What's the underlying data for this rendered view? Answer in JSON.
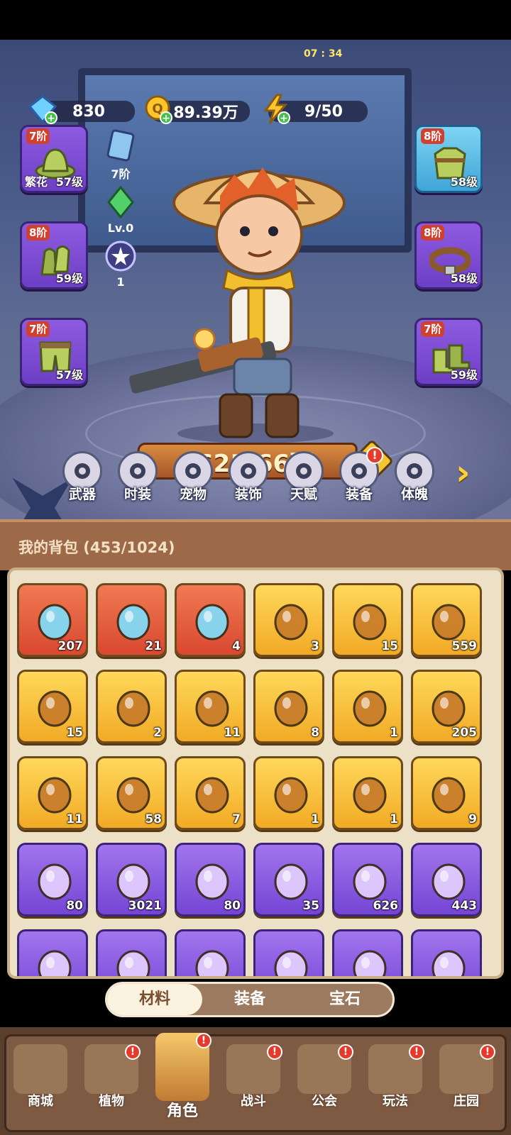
{
  "resources": {
    "diamonds": "830",
    "gold": "89.39万",
    "energy": "9/50",
    "energy_timer": "07 : 34"
  },
  "equipment_left": [
    {
      "tier": "7阶",
      "level": "57级",
      "tag": "繁花",
      "item": "hat"
    },
    {
      "tier": "8阶",
      "level": "59级",
      "item": "gloves"
    },
    {
      "tier": "7阶",
      "level": "57级",
      "item": "pants"
    }
  ],
  "equipment_right": [
    {
      "tier": "8阶",
      "level": "58级",
      "item": "armor"
    },
    {
      "tier": "8阶",
      "level": "58级",
      "item": "belt"
    },
    {
      "tier": "7阶",
      "level": "59级",
      "item": "boots"
    }
  ],
  "mini_stats": {
    "rank": "7阶",
    "crystal_level": "Lv.0",
    "star_count": "1"
  },
  "power": "625.66万",
  "help_symbol": "?",
  "feature_tabs": [
    {
      "label": "武器",
      "icon": "weapon-icon",
      "badge": ""
    },
    {
      "label": "时装",
      "icon": "costume-icon",
      "badge": ""
    },
    {
      "label": "宠物",
      "icon": "pet-icon",
      "badge": ""
    },
    {
      "label": "装饰",
      "icon": "mask-icon",
      "badge": ""
    },
    {
      "label": "天赋",
      "icon": "talent-icon",
      "badge": ""
    },
    {
      "label": "装备",
      "icon": "equipment-icon",
      "badge": "!"
    },
    {
      "label": "体魄",
      "icon": "physique-icon",
      "badge": ""
    }
  ],
  "bag": {
    "title": "我的背包 (453/1024)",
    "items": [
      {
        "count": "207",
        "rarity": "red",
        "icon": "crystal-icon"
      },
      {
        "count": "21",
        "rarity": "red",
        "icon": "potion-icon"
      },
      {
        "count": "4",
        "rarity": "red",
        "icon": "canister-icon"
      },
      {
        "count": "3",
        "rarity": "gold",
        "icon": "water-drop-icon"
      },
      {
        "count": "15",
        "rarity": "gold",
        "icon": "skull-scroll-icon"
      },
      {
        "count": "559",
        "rarity": "gold",
        "icon": "ladybug-icon"
      },
      {
        "count": "15",
        "rarity": "gold",
        "icon": "key-icon"
      },
      {
        "count": "2",
        "rarity": "gold",
        "icon": "gem-key-icon"
      },
      {
        "count": "11",
        "rarity": "gold",
        "icon": "prism-icon"
      },
      {
        "count": "8",
        "rarity": "gold",
        "icon": "golden-flower-icon"
      },
      {
        "count": "1",
        "rarity": "gold",
        "icon": "rune-stone-icon"
      },
      {
        "count": "205",
        "rarity": "gold",
        "icon": "orange-potion-icon"
      },
      {
        "count": "11",
        "rarity": "gold",
        "icon": "gold-pile-icon"
      },
      {
        "count": "58",
        "rarity": "gold",
        "icon": "book-icon"
      },
      {
        "count": "7",
        "rarity": "gold",
        "icon": "can-icon"
      },
      {
        "count": "1",
        "rarity": "gold",
        "icon": "chip-icon"
      },
      {
        "count": "1",
        "rarity": "gold",
        "icon": "lily-icon"
      },
      {
        "count": "9",
        "rarity": "gold",
        "icon": "knot-icon"
      },
      {
        "count": "80",
        "rarity": "purple",
        "icon": "perfume-icon"
      },
      {
        "count": "3021",
        "rarity": "purple",
        "icon": "sprout-icon"
      },
      {
        "count": "80",
        "rarity": "purple",
        "icon": "badge-icon"
      },
      {
        "count": "35",
        "rarity": "purple",
        "icon": "leaf-icon"
      },
      {
        "count": "626",
        "rarity": "purple",
        "icon": "scroll-green-icon"
      },
      {
        "count": "443",
        "rarity": "purple",
        "icon": "scroll-purple-icon"
      },
      {
        "count": "",
        "rarity": "purple",
        "icon": "scroll-blue-icon"
      },
      {
        "count": "",
        "rarity": "purple",
        "icon": "scroll-red-icon"
      },
      {
        "count": "",
        "rarity": "purple",
        "icon": "scroll-gold-icon"
      },
      {
        "count": "",
        "rarity": "purple",
        "icon": "purple-potion-icon"
      },
      {
        "count": "",
        "rarity": "purple",
        "icon": "purple-orb-icon"
      },
      {
        "count": "",
        "rarity": "purple",
        "icon": "fruit-basket-icon"
      }
    ]
  },
  "bag_tabs": [
    "材料",
    "装备",
    "宝石"
  ],
  "bottom_nav": [
    {
      "label": "商城",
      "badge": ""
    },
    {
      "label": "植物",
      "badge": "!"
    },
    {
      "label": "角色",
      "badge": "!"
    },
    {
      "label": "战斗",
      "badge": "!"
    },
    {
      "label": "公会",
      "badge": "!"
    },
    {
      "label": "玩法",
      "badge": "!"
    },
    {
      "label": "庄园",
      "badge": "!"
    }
  ],
  "colors": {
    "gold_tier": "#f1aa25",
    "purple_tier": "#7445d4",
    "red_tier": "#d94830",
    "badge_red": "#e43b2d"
  }
}
